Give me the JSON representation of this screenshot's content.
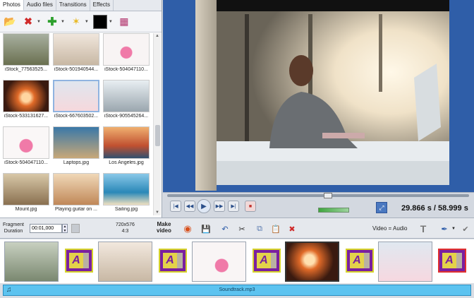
{
  "tabs": [
    "Photos",
    "Audio files",
    "Transitions",
    "Effects"
  ],
  "thumbnails": [
    {
      "label": "iStock_77563525..."
    },
    {
      "label": "iStock-501940544..."
    },
    {
      "label": "iStock-504047110..."
    },
    {
      "label": "iStock-533131627..."
    },
    {
      "label": "iStock-667603502..."
    },
    {
      "label": "iStock-905545264..."
    },
    {
      "label": "iStock-504047110..."
    },
    {
      "label": "Laptops.jpg"
    },
    {
      "label": "Los Angeles.jpg"
    },
    {
      "label": "Mount.jpg"
    },
    {
      "label": "Playing guitar on ..."
    },
    {
      "label": "Sailing.jpg"
    }
  ],
  "player": {
    "current_time": "29.866 s",
    "separator": " / ",
    "total_time": "58.999 s"
  },
  "toolbar": {
    "fragment_label_1": "Fragment",
    "fragment_label_2": "Duration",
    "fragment_value": "00:01,000",
    "resolution_1": "720x576",
    "resolution_2": "4:3",
    "make_video_1": "Make",
    "make_video_2": "video",
    "video_audio": "Video = Audio"
  },
  "soundtrack": {
    "label": "Soundtrack.mp3"
  },
  "colors": {
    "accent": "#2f5ea8",
    "soundtrack": "#5cc3f0",
    "transition": "#7a1fa0"
  }
}
